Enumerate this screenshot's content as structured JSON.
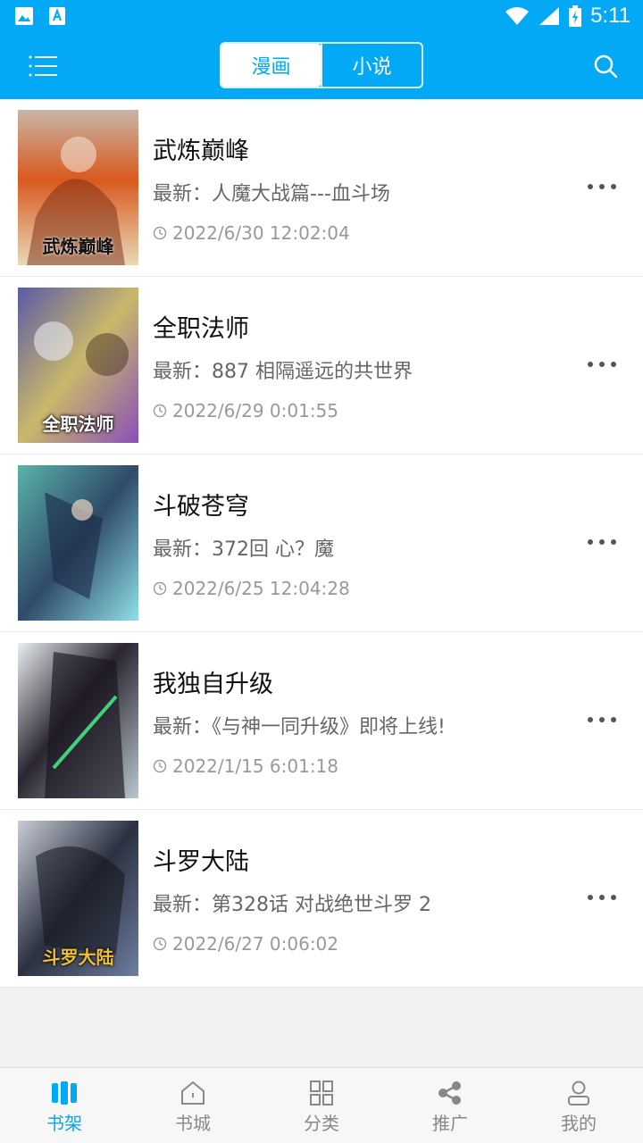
{
  "status_bar": {
    "time": "5:11",
    "icons": [
      "image-icon",
      "font-icon",
      "wifi-icon",
      "signal-icon",
      "battery-icon"
    ]
  },
  "app_bar": {
    "tabs": [
      {
        "label": "漫画",
        "active": true
      },
      {
        "label": "小说",
        "active": false
      }
    ],
    "menu_icon": "menu-icon",
    "search_icon": "search-icon"
  },
  "books": [
    {
      "title": "武炼巅峰",
      "latest": "最新：人魔大战篇---血斗场",
      "time": "2022/6/30 12:02:04",
      "cover_text": "武炼巅峰"
    },
    {
      "title": "全职法师",
      "latest": "最新：887 相隔遥远的共世界",
      "time": "2022/6/29 0:01:55",
      "cover_text": "全职法师"
    },
    {
      "title": "斗破苍穹",
      "latest": "最新：372回 心？魔",
      "time": "2022/6/25 12:04:28",
      "cover_text": ""
    },
    {
      "title": "我独自升级",
      "latest": "最新：《与神一同升级》即将上线!",
      "time": "2022/1/15 6:01:18",
      "cover_text": ""
    },
    {
      "title": "斗罗大陆",
      "latest": "最新：第328话 对战绝世斗罗 2",
      "time": "2022/6/27 0:06:02",
      "cover_text": "斗罗大陆"
    }
  ],
  "bottom_nav": [
    {
      "label": "书架",
      "icon": "bookshelf-icon",
      "active": true
    },
    {
      "label": "书城",
      "icon": "home-icon",
      "active": false
    },
    {
      "label": "分类",
      "icon": "grid-icon",
      "active": false
    },
    {
      "label": "推广",
      "icon": "share-icon",
      "active": false
    },
    {
      "label": "我的",
      "icon": "user-icon",
      "active": false
    }
  ],
  "colors": {
    "accent": "#03a9f4",
    "text_primary": "#111111",
    "text_secondary": "#666666",
    "text_muted": "#999999"
  }
}
